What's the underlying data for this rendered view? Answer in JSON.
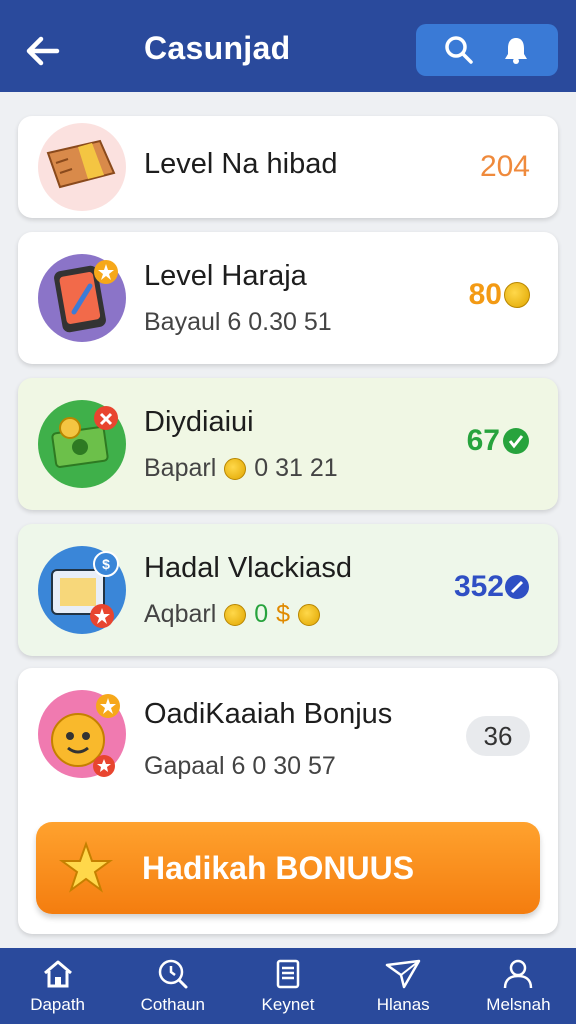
{
  "header": {
    "title": "Casunjad",
    "back_icon": "arrow-left-icon",
    "actions": [
      "search-icon",
      "bell-icon"
    ],
    "color": "#2a4a9c",
    "action_bg": "#3a7ad6"
  },
  "cards": [
    {
      "title": "Level Na hibad",
      "value": "204",
      "icon": "ticket-icon",
      "value_color": "#ef8a3c"
    },
    {
      "title": "Level Haraja",
      "subtitle": "Bayaul 6 0.30 51",
      "value": "80",
      "icon": "phone-icon",
      "value_color": "#f39a14"
    },
    {
      "title": "Diydiaiui",
      "subtitle_prefix": "Baparl",
      "subtitle_suffix": "0 31 21",
      "value": "67",
      "icon": "money-icon",
      "value_color": "#27a33d"
    },
    {
      "title": "Hadal Vlackiasd",
      "subtitle_prefix": "Aqbarl",
      "subtitle_mid": "0",
      "subtitle_suffix": "$",
      "value": "352",
      "icon": "tablet-icon",
      "value_color": "#2f4fc4"
    },
    {
      "title": "OadiKaaiah Bonjus",
      "subtitle": "Gapaal 6 0 30 57",
      "value": "36",
      "icon": "smiley-icon"
    }
  ],
  "bonus_button": {
    "label": "Hadikah BONUUS",
    "icon": "star-icon",
    "color": "#f47d0f"
  },
  "bottom_nav": [
    {
      "label": "Dapath",
      "icon": "home-icon"
    },
    {
      "label": "Cothaun",
      "icon": "clock-search-icon"
    },
    {
      "label": "Keynet",
      "icon": "document-icon"
    },
    {
      "label": "Hlanas",
      "icon": "paper-plane-icon"
    },
    {
      "label": "Melsnah",
      "icon": "person-icon"
    }
  ]
}
